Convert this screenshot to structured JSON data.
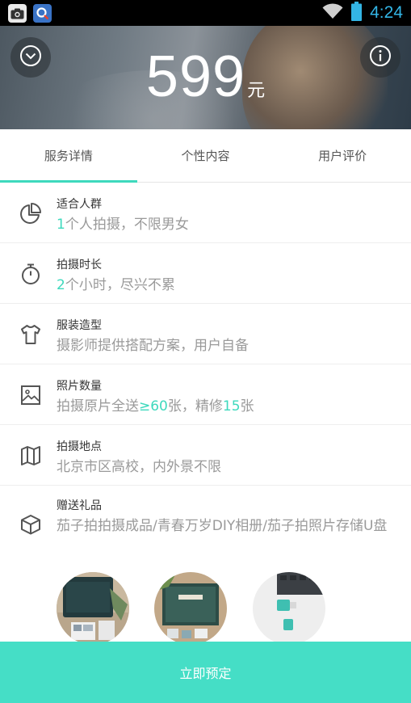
{
  "status_bar": {
    "time": "4:24",
    "left_icons": [
      "camera-app-icon",
      "app-notification-icon"
    ],
    "right_icons": [
      "wifi-icon",
      "battery-icon"
    ]
  },
  "hero": {
    "price": "599",
    "currency": "元",
    "left_button_icon": "chevron-down-circle-icon",
    "right_button_icon": "info-icon"
  },
  "tabs": [
    {
      "label": "服务详情",
      "active": true
    },
    {
      "label": "个性内容",
      "active": false
    },
    {
      "label": "用户评价",
      "active": false
    }
  ],
  "details": [
    {
      "icon": "pie-chart-icon",
      "title": "适合人群",
      "desc_hl": "1",
      "desc_rest": "个人拍摄，不限男女"
    },
    {
      "icon": "stopwatch-icon",
      "title": "拍摄时长",
      "desc_hl": "2",
      "desc_rest": "个小时，尽兴不累"
    },
    {
      "icon": "shirt-icon",
      "title": "服装造型",
      "desc": "摄影师提供搭配方案，用户自备"
    },
    {
      "icon": "image-icon",
      "title": "照片数量",
      "desc_pre": "拍摄原片全送",
      "desc_hl1": "≥60",
      "desc_mid": "张，精修",
      "desc_hl2": "15",
      "desc_post": "张"
    },
    {
      "icon": "map-icon",
      "title": "拍摄地点",
      "desc": "北京市区高校，内外景不限"
    },
    {
      "icon": "gift-box-icon",
      "title": "赠送礼品",
      "desc": "茄子拍拍摄成品/青春万岁DIY相册/茄子拍照片存储U盘"
    }
  ],
  "gift_images": [
    "photo-album-image",
    "photo-book-image",
    "usb-drive-image"
  ],
  "book_button": "立即预定",
  "colors": {
    "accent": "#3ed9bd",
    "button": "#45dec6",
    "status_time": "#33b5e5"
  }
}
